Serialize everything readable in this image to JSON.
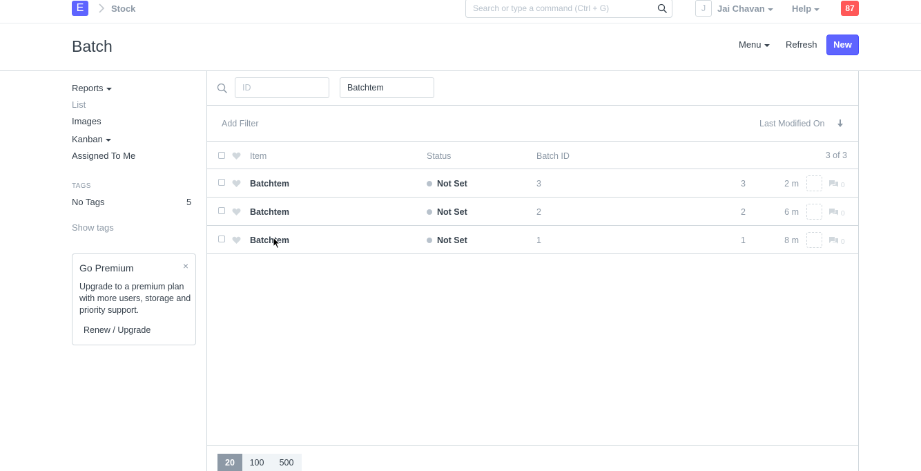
{
  "navbar": {
    "logo_letter": "E",
    "breadcrumb": "Stock",
    "search_placeholder": "Search or type a command (Ctrl + G)",
    "avatar_letter": "J",
    "user_name": "Jai Chavan",
    "help_label": "Help",
    "notification_count": "87"
  },
  "page": {
    "title": "Batch",
    "menu_label": "Menu",
    "refresh_label": "Refresh",
    "new_label": "New"
  },
  "sidebar": {
    "items": [
      {
        "label": "Reports",
        "has_caret": true
      },
      {
        "label": "List",
        "has_caret": false
      },
      {
        "label": "Images",
        "has_caret": false
      },
      {
        "label": "Kanban",
        "has_caret": true
      },
      {
        "label": "Assigned To Me",
        "has_caret": false
      }
    ],
    "tags_heading": "TAGS",
    "no_tags_label": "No Tags",
    "no_tags_count": "5",
    "show_tags_label": "Show tags"
  },
  "premium": {
    "title": "Go Premium",
    "close": "×",
    "text": "Upgrade to a premium plan with more users, storage and priority support.",
    "link": "Renew / Upgrade"
  },
  "filters": {
    "id_placeholder": "ID",
    "item_value": "Batchtem",
    "add_filter_label": "Add Filter",
    "sort_label": "Last Modified On"
  },
  "list": {
    "columns": {
      "item": "Item",
      "status": "Status",
      "batch_id": "Batch ID"
    },
    "count_label": "3 of 3",
    "rows": [
      {
        "item": "Batchtem",
        "status": "Not Set",
        "batch_id": "3",
        "num": "3",
        "modified": "2 m",
        "comments": "0"
      },
      {
        "item": "Batchtem",
        "status": "Not Set",
        "batch_id": "2",
        "num": "2",
        "modified": "6 m",
        "comments": "0"
      },
      {
        "item": "Batchtem",
        "status": "Not Set",
        "batch_id": "1",
        "num": "1",
        "modified": "8 m",
        "comments": "0"
      }
    ]
  },
  "paging": {
    "options": [
      "20",
      "100",
      "500"
    ],
    "selected": "20"
  },
  "colors": {
    "primary": "#5e64ff",
    "notification": "#ff5858",
    "muted_text": "#8d99a6",
    "border": "#d1d8dd"
  }
}
